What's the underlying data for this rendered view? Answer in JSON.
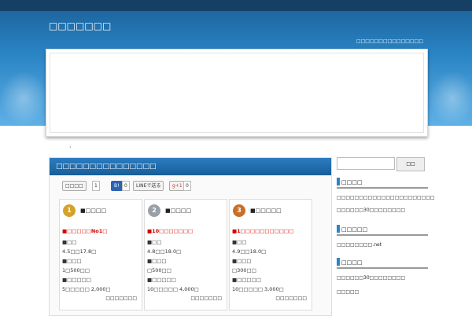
{
  "header": {
    "title": "□□□□□□□",
    "description": "□□□□□□□□□□□□□□□"
  },
  "bullet_dot": "·",
  "main": {
    "title": "□□□□□□□□□□□□□□□",
    "share": {
      "tweet_label": "□□□□",
      "tweet_count": "1",
      "hatena_count": "0",
      "line_label": "LINEで送る",
      "gplus_label": "g+1",
      "gplus_count": "0"
    },
    "cards": [
      {
        "rank": "1",
        "name": "■□□□□",
        "highlight": "■□□□□□No1□",
        "lines": [
          "■□□",
          "4.5□□17.8□",
          "■□□□",
          "1□500□□",
          "■□□□□□",
          "5□□□□□ 2,000□"
        ],
        "link": "□□□□□□□",
        "color": "#d4a22a"
      },
      {
        "rank": "2",
        "name": "■□□□□",
        "highlight": "■10□□□□□□□",
        "lines": [
          "■□□",
          "4.8□□18.0□",
          "■□□□",
          "□500□□",
          "■□□□□□",
          "10□□□□□ 4,000□"
        ],
        "link": "□□□□□□□",
        "color": "#9aa0a8"
      },
      {
        "rank": "3",
        "name": "■□□□□□",
        "highlight": "■1□□□□□□□□□□□",
        "lines": [
          "■□□",
          "4.9□□18.0□",
          "■□□□",
          "□300□□",
          "■□□□□□",
          "10□□□□□ 3,000□"
        ],
        "link": "□□□□□□□",
        "color": "#c8702a"
      }
    ]
  },
  "sidebar": {
    "search_button": "□□",
    "section1_title": "□□□□",
    "section1_items": [
      "□□□□□□□□□□□□□□□□□□□□□□",
      "□□□□□□30□□□□□□□□"
    ],
    "section2_title": "□□□□□",
    "section2_items": [
      "□□□□□□□□.net"
    ],
    "section3_title": "□□□□",
    "section3_items": [
      "□□□□□□30□□□□□□□□",
      "□□□□□"
    ]
  }
}
